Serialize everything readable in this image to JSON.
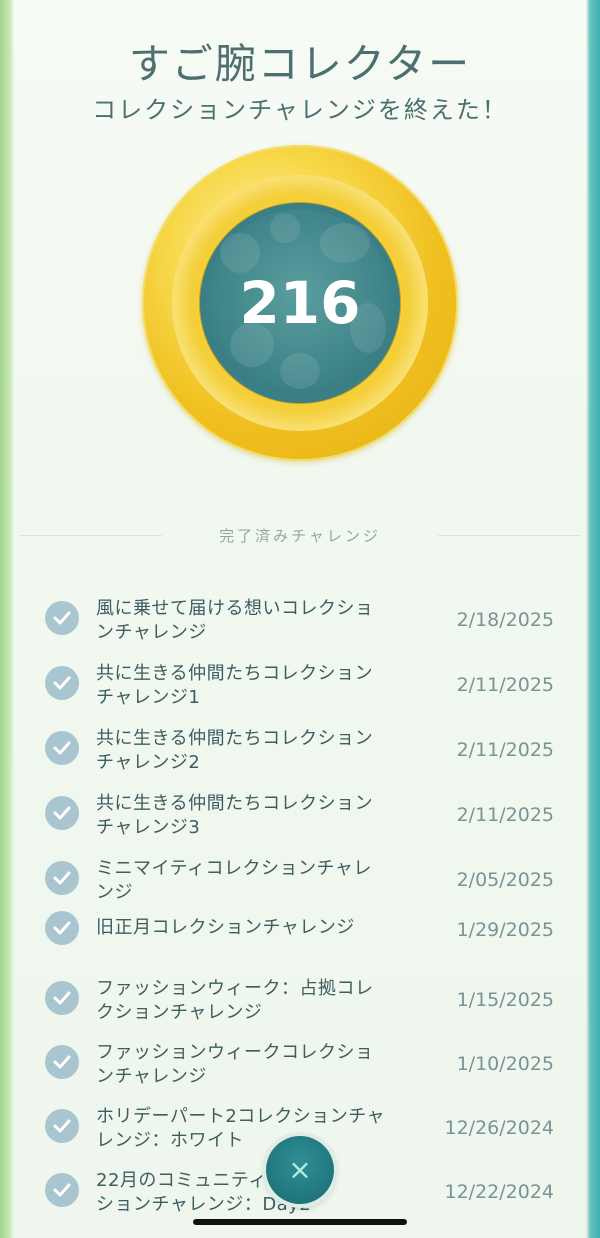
{
  "header": {
    "title": "すご腕コレクター",
    "subtitle": "コレクションチャレンジを終えた！"
  },
  "medal": {
    "count": "216",
    "colors": {
      "gold": "#f0c020",
      "inner": "#3f8589"
    }
  },
  "section": {
    "label": "完了済みチャレンジ"
  },
  "challenges": [
    {
      "title_lines": [
        "風に乗せて届ける想いコレクショ",
        "ンチャレンジ"
      ],
      "date": "2/18/2025"
    },
    {
      "title_lines": [
        "共に生きる仲間たちコレクション",
        "チャレンジ1"
      ],
      "date": "2/11/2025"
    },
    {
      "title_lines": [
        "共に生きる仲間たちコレクション",
        "チャレンジ2"
      ],
      "date": "2/11/2025"
    },
    {
      "title_lines": [
        "共に生きる仲間たちコレクション",
        "チャレンジ3"
      ],
      "date": "2/11/2025"
    },
    {
      "title_lines": [
        "ミニマイティコレクションチャレ",
        "ンジ"
      ],
      "date": "2/05/2025"
    },
    {
      "title_lines": [
        "旧正月コレクションチャレンジ"
      ],
      "date": "1/29/2025"
    },
    {
      "title_lines": [
        "ファッションウィーク：占拠コレ",
        "クションチャレンジ"
      ],
      "date": "1/15/2025"
    },
    {
      "title_lines": [
        "ファッションウィークコレクショ",
        "ンチャレンジ"
      ],
      "date": "1/10/2025"
    },
    {
      "title_lines": [
        "ホリデーパート2コレクションチャ",
        "レンジ：ホワイト"
      ],
      "date": "12/26/2024"
    },
    {
      "title_lines": [
        "22月のコミュニティ",
        "ションチャレンジ：Day2"
      ],
      "date": "12/22/2024"
    }
  ],
  "close_button": {
    "icon": "close-icon",
    "glyph": "×"
  }
}
